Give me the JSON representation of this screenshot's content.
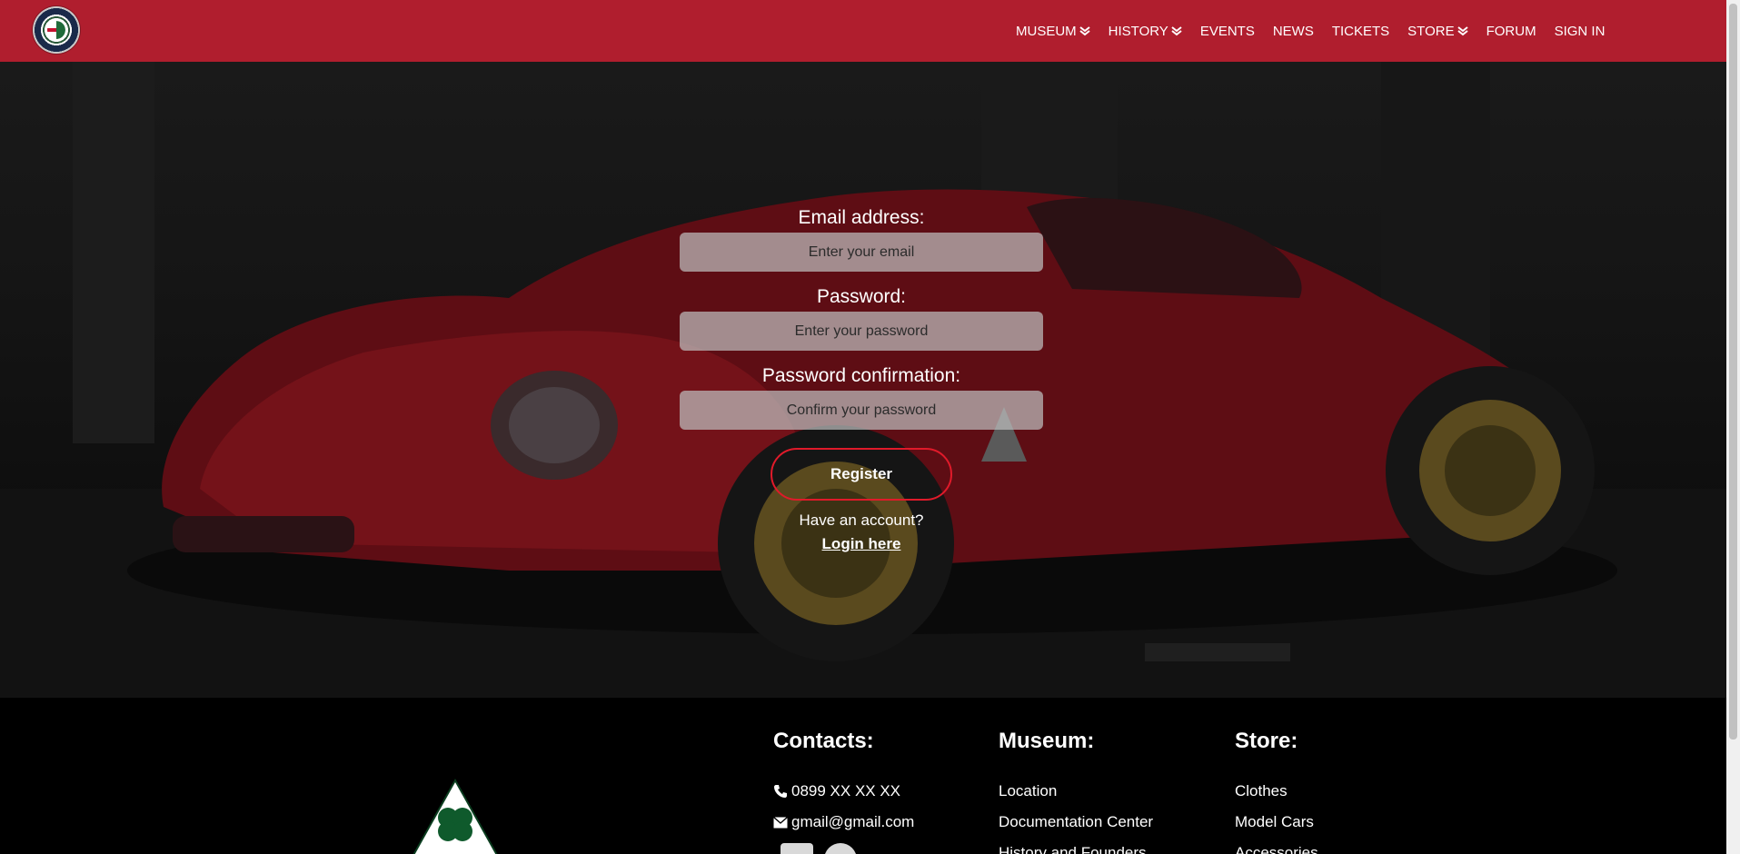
{
  "nav": {
    "logo_icon": "alfa-romeo-logo",
    "items": [
      {
        "label": "MUSEUM",
        "dropdown": true
      },
      {
        "label": "HISTORY",
        "dropdown": true
      },
      {
        "label": "EVENTS",
        "dropdown": false
      },
      {
        "label": "NEWS",
        "dropdown": false
      },
      {
        "label": "TICKETS",
        "dropdown": false
      },
      {
        "label": "STORE",
        "dropdown": true
      },
      {
        "label": "FORUM",
        "dropdown": false
      },
      {
        "label": "SIGN IN",
        "dropdown": false
      }
    ]
  },
  "form": {
    "email_label": "Email address:",
    "email_placeholder": "Enter your email",
    "password_label": "Password:",
    "password_placeholder": "Enter your password",
    "confirm_label": "Password confirmation:",
    "confirm_placeholder": "Confirm your password",
    "register_label": "Register",
    "account_text": "Have an account?",
    "login_link": "Login here"
  },
  "footer": {
    "contacts": {
      "title": "Contacts:",
      "phone": "0899 XX XX XX",
      "email": "gmail@gmail.com",
      "social_icons": [
        "linkedin-icon",
        "chat-icon"
      ]
    },
    "museum": {
      "title": "Museum:",
      "links": [
        "Location",
        "Documentation Center",
        "History and Founders"
      ]
    },
    "store": {
      "title": "Store:",
      "links": [
        "Clothes",
        "Model Cars",
        "Accessories"
      ]
    }
  },
  "colors": {
    "navbar": "#b01e2e",
    "button_border": "#e01a2a",
    "footer": "#000000"
  }
}
